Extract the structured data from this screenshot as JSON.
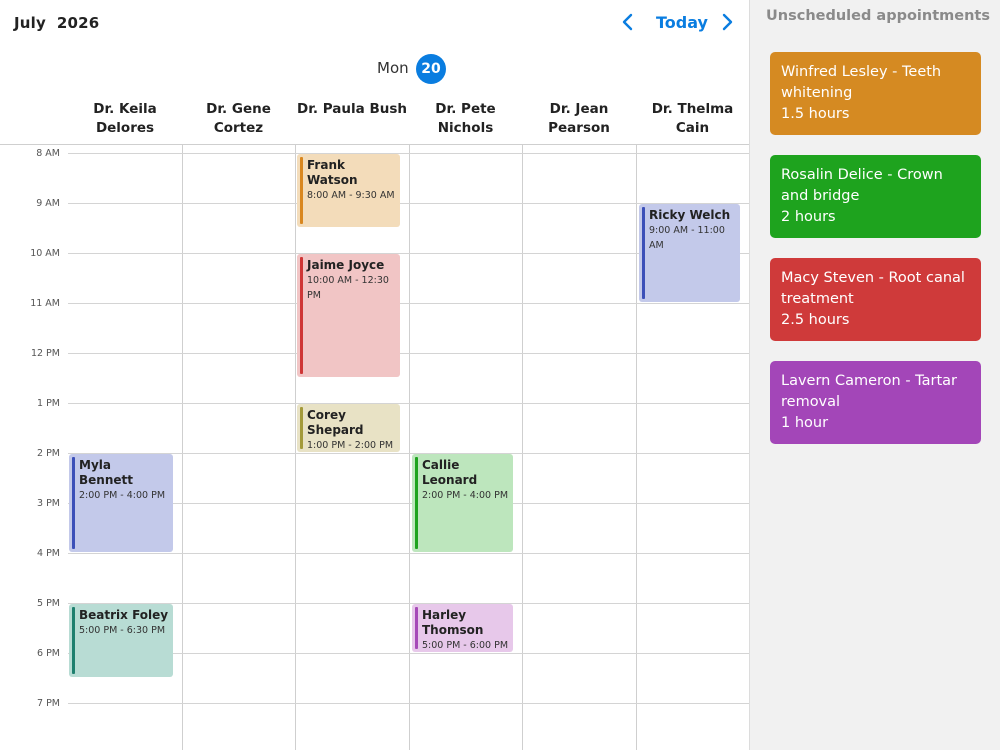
{
  "header": {
    "title": "July  2026",
    "today_label": "Today",
    "prev_icon": "chevron-left-icon",
    "next_icon": "chevron-right-icon",
    "accent": "#0a7de0"
  },
  "day": {
    "weekday": "Mon",
    "date": "20"
  },
  "resources": [
    {
      "line1": "Dr. Keila",
      "line2": "Delores"
    },
    {
      "line1": "Dr. Gene",
      "line2": "Cortez"
    },
    {
      "line1": "Dr. Paula Bush",
      "line2": ""
    },
    {
      "line1": "Dr. Pete",
      "line2": "Nichols"
    },
    {
      "line1": "Dr. Jean",
      "line2": "Pearson"
    },
    {
      "line1": "Dr. Thelma",
      "line2": "Cain"
    }
  ],
  "times": [
    "8 AM",
    "9 AM",
    "10 AM",
    "11 AM",
    "12 PM",
    "1 PM",
    "2 PM",
    "3 PM",
    "4 PM",
    "5 PM",
    "6 PM",
    "7 PM"
  ],
  "events": [
    {
      "name": "Frank Watson",
      "time": "8:00 AM - 9:30 AM",
      "bg": "#f3dcba",
      "bar": "#d9871f"
    },
    {
      "name": "Jaime Joyce",
      "time": "10:00 AM - 12:30 PM",
      "bg": "#f1c5c5",
      "bar": "#cf3636"
    },
    {
      "name": "Corey Shepard",
      "time": "1:00 PM - 2:00 PM",
      "bg": "#e8e2c5",
      "bar": "#a39a3a"
    },
    {
      "name": "Ricky Welch",
      "time": "9:00 AM - 11:00 AM",
      "bg": "#c3c9ea",
      "bar": "#3b4fb8"
    },
    {
      "name": "Myla Bennett",
      "time": "2:00 PM - 4:00 PM",
      "bg": "#c3c9ea",
      "bar": "#3b4fb8"
    },
    {
      "name": "Callie Leonard",
      "time": "2:00 PM - 4:00 PM",
      "bg": "#bde6bd",
      "bar": "#1ea31e"
    },
    {
      "name": "Beatrix Foley",
      "time": "5:00 PM - 6:30 PM",
      "bg": "#b8dcd4",
      "bar": "#1e7f6e"
    },
    {
      "name": "Harley Thomson",
      "time": "5:00 PM - 6:00 PM",
      "bg": "#e7c8ea",
      "bar": "#a64ab8"
    }
  ],
  "sidebar": {
    "title": "Unscheduled appointments",
    "cards": [
      {
        "title": "Winfred Lesley - Teeth whitening",
        "duration": "1.5 hours",
        "color": "#d58a22"
      },
      {
        "title": "Rosalin Delice - Crown and bridge",
        "duration": "2 hours",
        "color": "#1ea31e"
      },
      {
        "title": "Macy Steven - Root canal treatment",
        "duration": "2.5 hours",
        "color": "#cf3a3a"
      },
      {
        "title": "Lavern Cameron - Tartar removal",
        "duration": "1 hour",
        "color": "#a346b8"
      }
    ]
  }
}
